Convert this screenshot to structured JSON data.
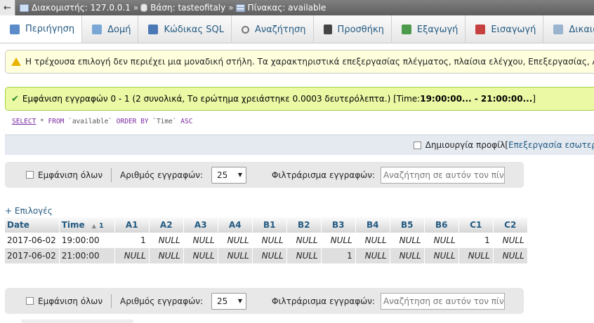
{
  "breadcrumb": {
    "back": "←",
    "server": "Διακομιστής: 127.0.0.1",
    "sep": "»",
    "database": "Βάση: tasteofitaly",
    "table": "Πίνακας: available"
  },
  "tabs": [
    {
      "label": "Περιήγηση"
    },
    {
      "label": "Δομή"
    },
    {
      "label": "Κώδικας SQL"
    },
    {
      "label": "Αναζήτηση"
    },
    {
      "label": "Προσθήκη"
    },
    {
      "label": "Εξαγωγή"
    },
    {
      "label": "Εισαγωγή"
    },
    {
      "label": "Δικαιώματα"
    }
  ],
  "notice": "Η τρέχουσα επιλογή δεν περιέχει μια μοναδική στήλη. Τα χαρακτηριστικά επεξεργασίας πλέγματος, πλαίσια ελέγχου, Επεξεργασίας, Αντιγραφής",
  "success": {
    "text": "Εμφάνιση εγγραφών 0 - 1 (2 συνολικά, Το ερώτημα χρειάστηκε 0.0003 δευτερόλεπτα.) [Time: ",
    "range": "19:00:00... - 21:00:00...",
    "close": "]"
  },
  "sql": {
    "select": "SELECT",
    "star": " * ",
    "from": "FROM",
    "table": " `available` ",
    "order": "ORDER BY",
    "col": " `Time` ",
    "asc": "ASC"
  },
  "profiling": {
    "label": "Δημιουργία προφίλ",
    "bracket": " [ ",
    "edit": "Επεξεργασία εσωτερικά"
  },
  "nav": {
    "show_all": "Εμφάνιση όλων",
    "num_rows_label": "Αριθμός εγγραφών:",
    "num_rows_value": "25",
    "filter_label": "Φιλτράρισμα εγγραφών:",
    "filter_placeholder": "Αναζήτηση σε αυτόν τον πίνακα"
  },
  "options": "+ Επιλογές",
  "table": {
    "headers": [
      "Date",
      "Time",
      "A1",
      "A2",
      "A3",
      "A4",
      "B1",
      "B2",
      "B3",
      "B4",
      "B5",
      "B6",
      "C1",
      "C2"
    ],
    "sort_num": "1",
    "rows": [
      [
        "2017-06-02",
        "19:00:00",
        "1",
        "NULL",
        "NULL",
        "NULL",
        "NULL",
        "NULL",
        "NULL",
        "NULL",
        "NULL",
        "NULL",
        "1",
        "NULL"
      ],
      [
        "2017-06-02",
        "21:00:00",
        "NULL",
        "NULL",
        "NULL",
        "NULL",
        "NULL",
        "NULL",
        "1",
        "NULL",
        "NULL",
        "NULL",
        "NULL",
        "NULL"
      ]
    ]
  }
}
